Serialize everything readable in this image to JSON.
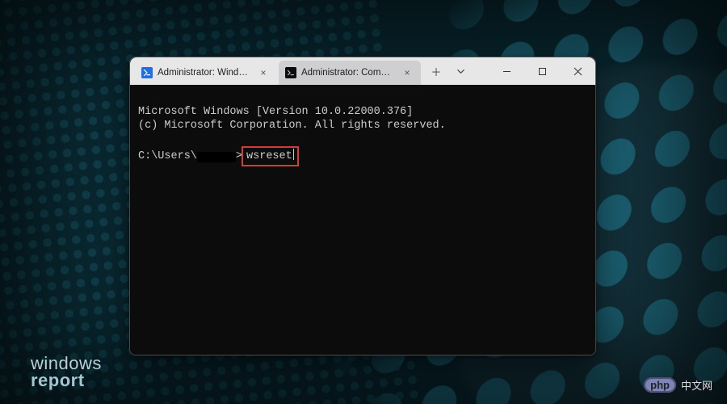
{
  "tabs": [
    {
      "label": "Administrator: Windows PowerS",
      "active": false,
      "icon": "powershell"
    },
    {
      "label": "Administrator: Command Promp",
      "active": true,
      "icon": "cmd"
    }
  ],
  "titlebar": {
    "new_tab_tooltip": "New tab",
    "tab_dropdown_tooltip": "Tab options"
  },
  "window_controls": {
    "minimize": "Minimize",
    "maximize": "Maximize",
    "close": "Close"
  },
  "terminal": {
    "line1": "Microsoft Windows [Version 10.0.22000.376]",
    "line2": "(c) Microsoft Corporation. All rights reserved.",
    "prompt_prefix": "C:\\Users\\",
    "prompt_suffix": ">",
    "command": "wsreset"
  },
  "redaction_note": "username redacted in screenshot",
  "highlight_color": "#d63a3a",
  "watermarks": {
    "wr_line1": "windows",
    "wr_line2": "report",
    "php_pill": "php",
    "php_text": "中文网"
  }
}
